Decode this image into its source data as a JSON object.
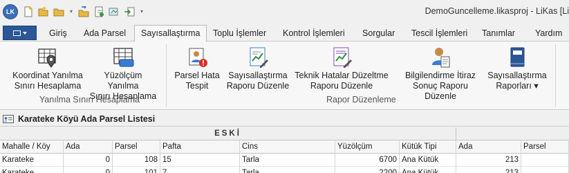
{
  "window": {
    "title": "DemoGuncelleme.likasproj - LiKas [Li",
    "logo": "LK"
  },
  "qat": [
    "new-icon",
    "open-folder-icon",
    "folder-icon",
    "folder-arrow-icon",
    "undo-folder-icon",
    "refresh-doc-icon",
    "export-icon",
    "import-icon",
    "customize-icon"
  ],
  "tabs": [
    {
      "label": "Giriş"
    },
    {
      "label": "Ada Parsel"
    },
    {
      "label": "Sayısallaştırma",
      "active": true
    },
    {
      "label": "Toplu İşlemler"
    },
    {
      "label": "Kontrol İşlemleri"
    },
    {
      "label": "Sorgular"
    },
    {
      "label": "Tescil İşlemleri"
    },
    {
      "label": "Tanımlar"
    },
    {
      "label": "Yardım"
    }
  ],
  "ribbon": {
    "groups": [
      {
        "label": "Yanılma Sınırı Hesaplama",
        "buttons": [
          {
            "line1": "Koordinat Yanılma",
            "line2": "Sınırı Hesaplama",
            "icon": "grid-pin-icon"
          },
          {
            "line1": "Yüzölçüm Yanılma",
            "line2": "Sınırı Hesaplama",
            "icon": "grid-ruler-icon"
          }
        ]
      },
      {
        "label": "Rapor Düzenleme",
        "buttons": [
          {
            "line1": "Parsel Hata",
            "line2": "Tespit",
            "icon": "person-card-error-icon"
          },
          {
            "line1": "Sayısallaştırma",
            "line2": "Raporu Düzenle",
            "icon": "chart-report-edit-icon"
          },
          {
            "line1": "Teknik Hatalar Düzeltme",
            "line2": "Raporu Düzenle",
            "icon": "report-edit-icon"
          },
          {
            "line1": "Bilgilendirme İtiraz",
            "line2": "Sonuç Raporu Düzenle",
            "icon": "person-document-icon"
          },
          {
            "line1": "Sayısallaştırma",
            "line2": "Raporları",
            "icon": "book-icon",
            "dropdown": "▾"
          }
        ]
      }
    ]
  },
  "panel": {
    "title": "Karateke Köyü Ada Parsel Listesi",
    "icon": "list-form-icon"
  },
  "grid": {
    "band": "ESKİ",
    "columns": [
      "Mahalle / Köy",
      "Ada",
      "Parsel",
      "Pafta",
      "Cins",
      "Yüzölçüm",
      "Kütük Tipi",
      "Ada",
      "Parsel"
    ],
    "rows": [
      [
        "Karateke",
        "0",
        "108",
        "15",
        "Tarla",
        "6700",
        "Ana Kütük",
        "213",
        ""
      ],
      [
        "Karateke",
        "0",
        "101",
        "7",
        "Tarla",
        "2200",
        "Ana Kütük",
        "213",
        ""
      ]
    ]
  }
}
